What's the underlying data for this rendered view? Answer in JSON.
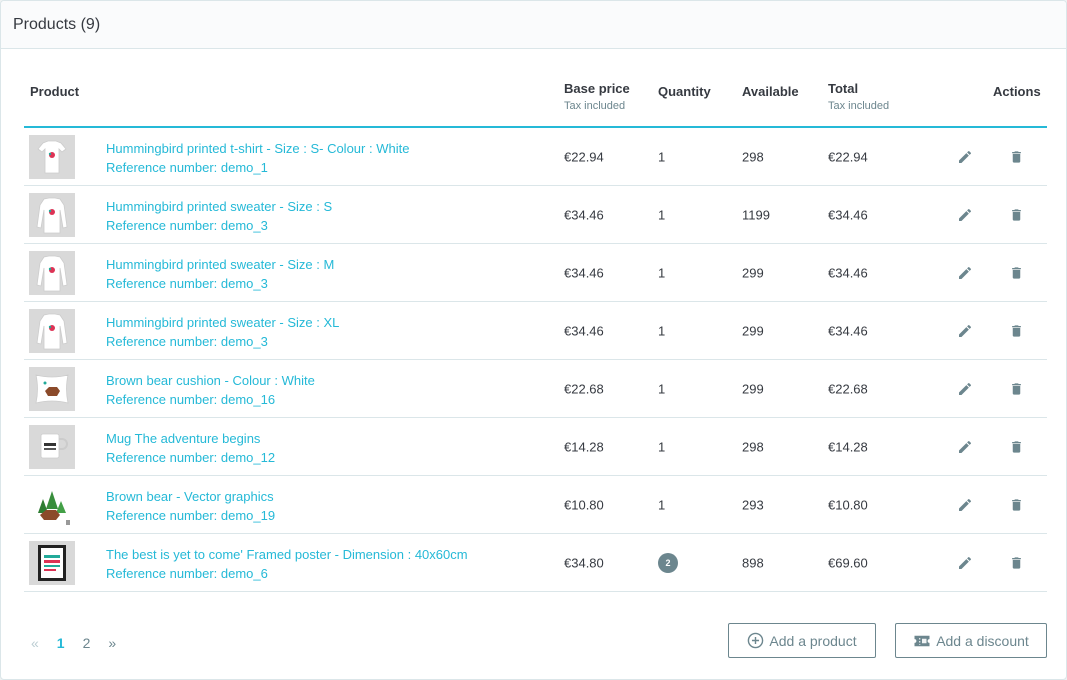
{
  "card": {
    "title": "Products (9)"
  },
  "table": {
    "headers": {
      "product": "Product",
      "base_price": "Base price",
      "base_price_sub": "Tax included",
      "quantity": "Quantity",
      "available": "Available",
      "total": "Total",
      "total_sub": "Tax included",
      "actions": "Actions"
    },
    "rows": [
      {
        "name": "Hummingbird printed t-shirt - Size : S- Colour : White",
        "ref": "Reference number: demo_1",
        "price": "€22.94",
        "qty": "1",
        "available": "298",
        "total": "€22.94",
        "thumb": "tshirt"
      },
      {
        "name": "Hummingbird printed sweater - Size : S",
        "ref": "Reference number: demo_3",
        "price": "€34.46",
        "qty": "1",
        "available": "1199",
        "total": "€34.46",
        "thumb": "sweater"
      },
      {
        "name": "Hummingbird printed sweater - Size : M",
        "ref": "Reference number: demo_3",
        "price": "€34.46",
        "qty": "1",
        "available": "299",
        "total": "€34.46",
        "thumb": "sweater"
      },
      {
        "name": "Hummingbird printed sweater - Size : XL",
        "ref": "Reference number: demo_3",
        "price": "€34.46",
        "qty": "1",
        "available": "299",
        "total": "€34.46",
        "thumb": "sweater"
      },
      {
        "name": "Brown bear cushion - Colour : White",
        "ref": "Reference number: demo_16",
        "price": "€22.68",
        "qty": "1",
        "available": "299",
        "total": "€22.68",
        "thumb": "cushion"
      },
      {
        "name": "Mug The adventure begins",
        "ref": "Reference number: demo_12",
        "price": "€14.28",
        "qty": "1",
        "available": "298",
        "total": "€14.28",
        "thumb": "mug"
      },
      {
        "name": "Brown bear - Vector graphics",
        "ref": "Reference number: demo_19",
        "price": "€10.80",
        "qty": "1",
        "available": "293",
        "total": "€10.80",
        "thumb": "vector"
      },
      {
        "name": "The best is yet to come' Framed poster - Dimension : 40x60cm",
        "ref": "Reference number: demo_6",
        "price": "€34.80",
        "qty": "2",
        "qty_badge": true,
        "available": "898",
        "total": "€69.60",
        "thumb": "poster"
      }
    ],
    "icons": {
      "edit": "pencil-icon",
      "delete": "trash-icon"
    }
  },
  "pagination": {
    "prev": "«",
    "pages": [
      "1",
      "2"
    ],
    "current": "1",
    "next": "»"
  },
  "buttons": {
    "add_product": {
      "label": "Add a product",
      "icon": "plus-circle-icon"
    },
    "add_discount": {
      "label": "Add a discount",
      "icon": "ticket-icon"
    }
  },
  "colors": {
    "accent": "#25b9d7",
    "muted": "#6c868e",
    "border": "#dbe6e9",
    "text": "#363a41"
  }
}
